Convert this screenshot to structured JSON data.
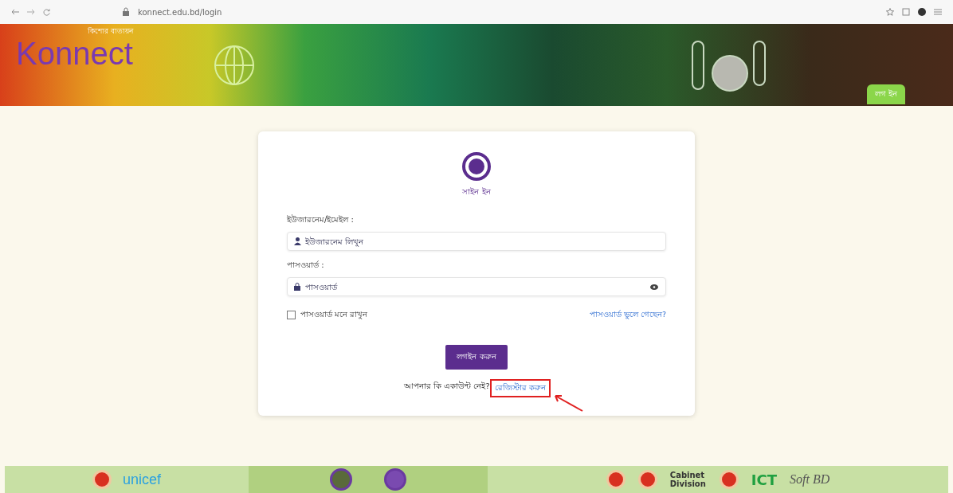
{
  "browser": {
    "url": "konnect.edu.bd/login"
  },
  "header": {
    "logo_text": "Konnect",
    "logo_tagline": "কিশোর বাতায়ন",
    "button": "লগ ইন"
  },
  "login_card": {
    "title": "সাইন ইন",
    "fields": [
      {
        "label": "ইউজারনেম/ইমেইল :",
        "placeholder": "ইউজারনেম লিখুন",
        "kind": "user"
      },
      {
        "label": "পাসওয়ার্ড :",
        "placeholder": "পাসওয়ার্ড",
        "kind": "password"
      }
    ],
    "remember": {
      "label": "পাসওয়ার্ড মনে রাখুন",
      "checked": false
    },
    "forgot_link": "পাসওয়ার্ড ভুলে গেছেন?",
    "submit": "লগইন করুন",
    "register_prompt": "আপনার কি একাউন্ট নেই?",
    "register_link": {
      "text": "রেজিস্টার করুন",
      "highlighted": true
    }
  },
  "footer": {
    "partners": [
      "unicef",
      "Cabinet Division",
      "ICT",
      "Soft BD"
    ]
  }
}
